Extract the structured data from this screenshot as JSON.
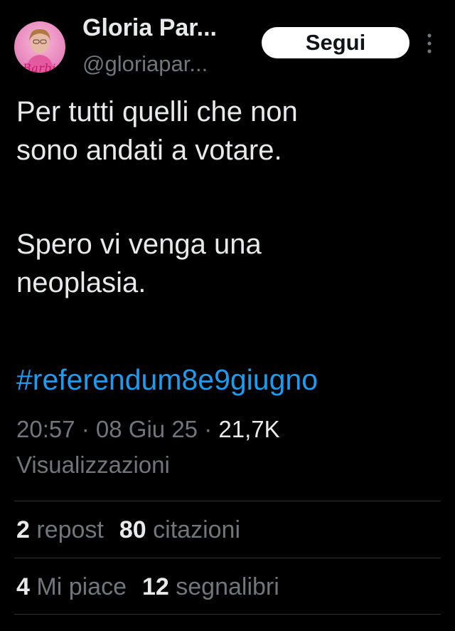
{
  "author": {
    "display_name": "Gloria Par...",
    "handle": "@gloriapar...",
    "avatar_text": "Barbie"
  },
  "follow_button": {
    "label": "Segui"
  },
  "tweet": {
    "lines": [
      "Per tutti quelli che non",
      "sono andati a votare.",
      "Spero vi venga una",
      "neoplasia."
    ],
    "hashtag": "#referendum8e9giugno",
    "time": "20:57",
    "sep1": " · ",
    "date": "08 Giu 25",
    "sep2": " · ",
    "views_count": "21,7K",
    "views_label": "Visualizzazioni"
  },
  "stats": {
    "reposts_count": "2",
    "reposts_label": "repost",
    "quotes_count": "80",
    "quotes_label": "citazioni",
    "likes_count": "4",
    "likes_label": "Mi piace",
    "bookmarks_count": "12",
    "bookmarks_label": "segnalibri"
  },
  "colors": {
    "background": "#000000",
    "text": "#e7e9ea",
    "secondary": "#71767b",
    "link": "#1d9bf0",
    "divider": "#2f3336"
  }
}
